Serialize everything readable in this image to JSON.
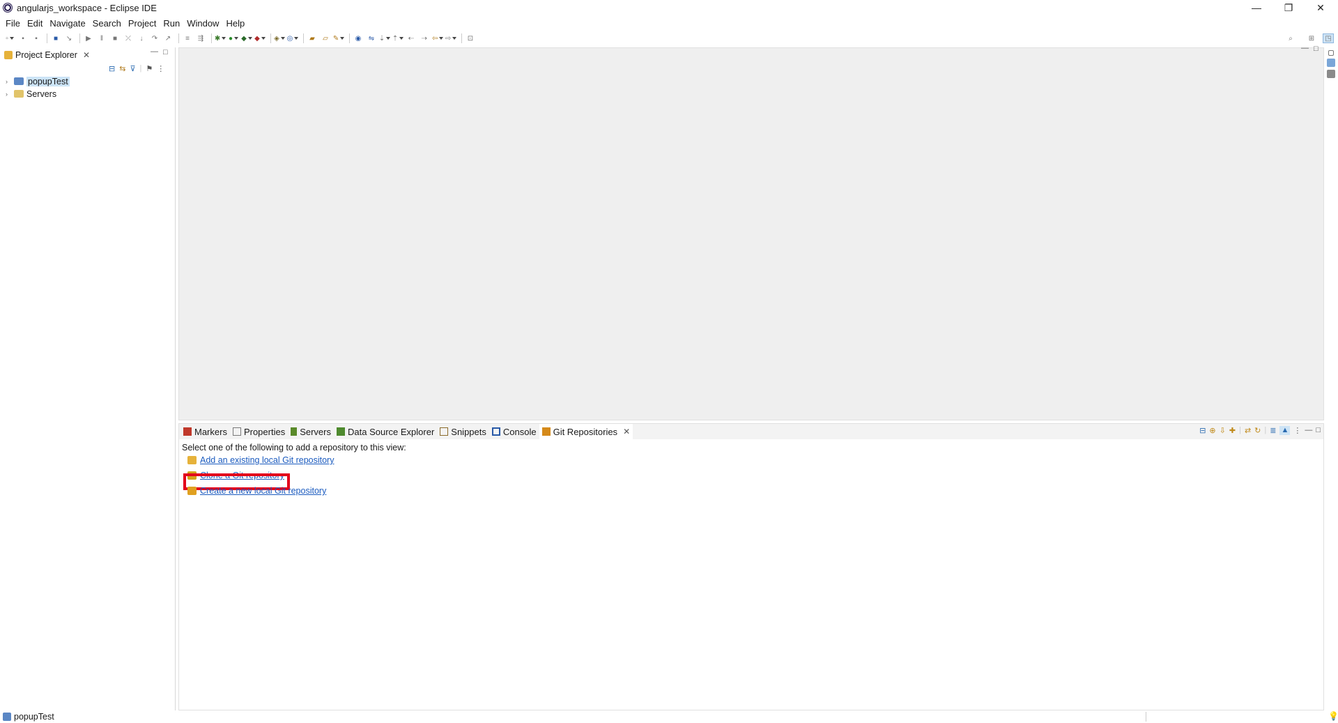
{
  "window": {
    "title": "angularjs_workspace - Eclipse IDE",
    "minimize": "—",
    "restore": "❐",
    "close": "✕"
  },
  "menu": [
    "File",
    "Edit",
    "Navigate",
    "Search",
    "Project",
    "Run",
    "Window",
    "Help"
  ],
  "left_view": {
    "tab_label": "Project Explorer",
    "tree": [
      {
        "label": "popupTest",
        "selected": true
      },
      {
        "label": "Servers",
        "selected": false
      }
    ]
  },
  "bottom_view": {
    "tabs": [
      {
        "label": "Markers",
        "icon": "markers-icon",
        "color": "#c0392b"
      },
      {
        "label": "Properties",
        "icon": "properties-icon",
        "color": "#7a7a7a"
      },
      {
        "label": "Servers",
        "icon": "servers-icon",
        "color": "#5a8a2a"
      },
      {
        "label": "Data Source Explorer",
        "icon": "database-icon",
        "color": "#4e8a2e"
      },
      {
        "label": "Snippets",
        "icon": "snippets-icon",
        "color": "#8a6a2a"
      },
      {
        "label": "Console",
        "icon": "console-icon",
        "color": "#2a5aa8"
      },
      {
        "label": "Git Repositories",
        "icon": "git-repo-icon",
        "color": "#d58a1a",
        "active": true
      }
    ],
    "intro_text": "Select one of the following to add a repository to this view:",
    "links": [
      {
        "label": "Add an existing local Git repository",
        "icon": "add-repo-icon"
      },
      {
        "label": "Clone a Git repository",
        "icon": "clone-repo-icon",
        "highlighted": true
      },
      {
        "label": "Create a new local Git repository",
        "icon": "create-repo-icon"
      }
    ]
  },
  "status_bar": {
    "text": "popupTest"
  },
  "colors": {
    "link": "#1b5bbf",
    "highlight": "#e3001b",
    "selection": "#cce4f7"
  }
}
